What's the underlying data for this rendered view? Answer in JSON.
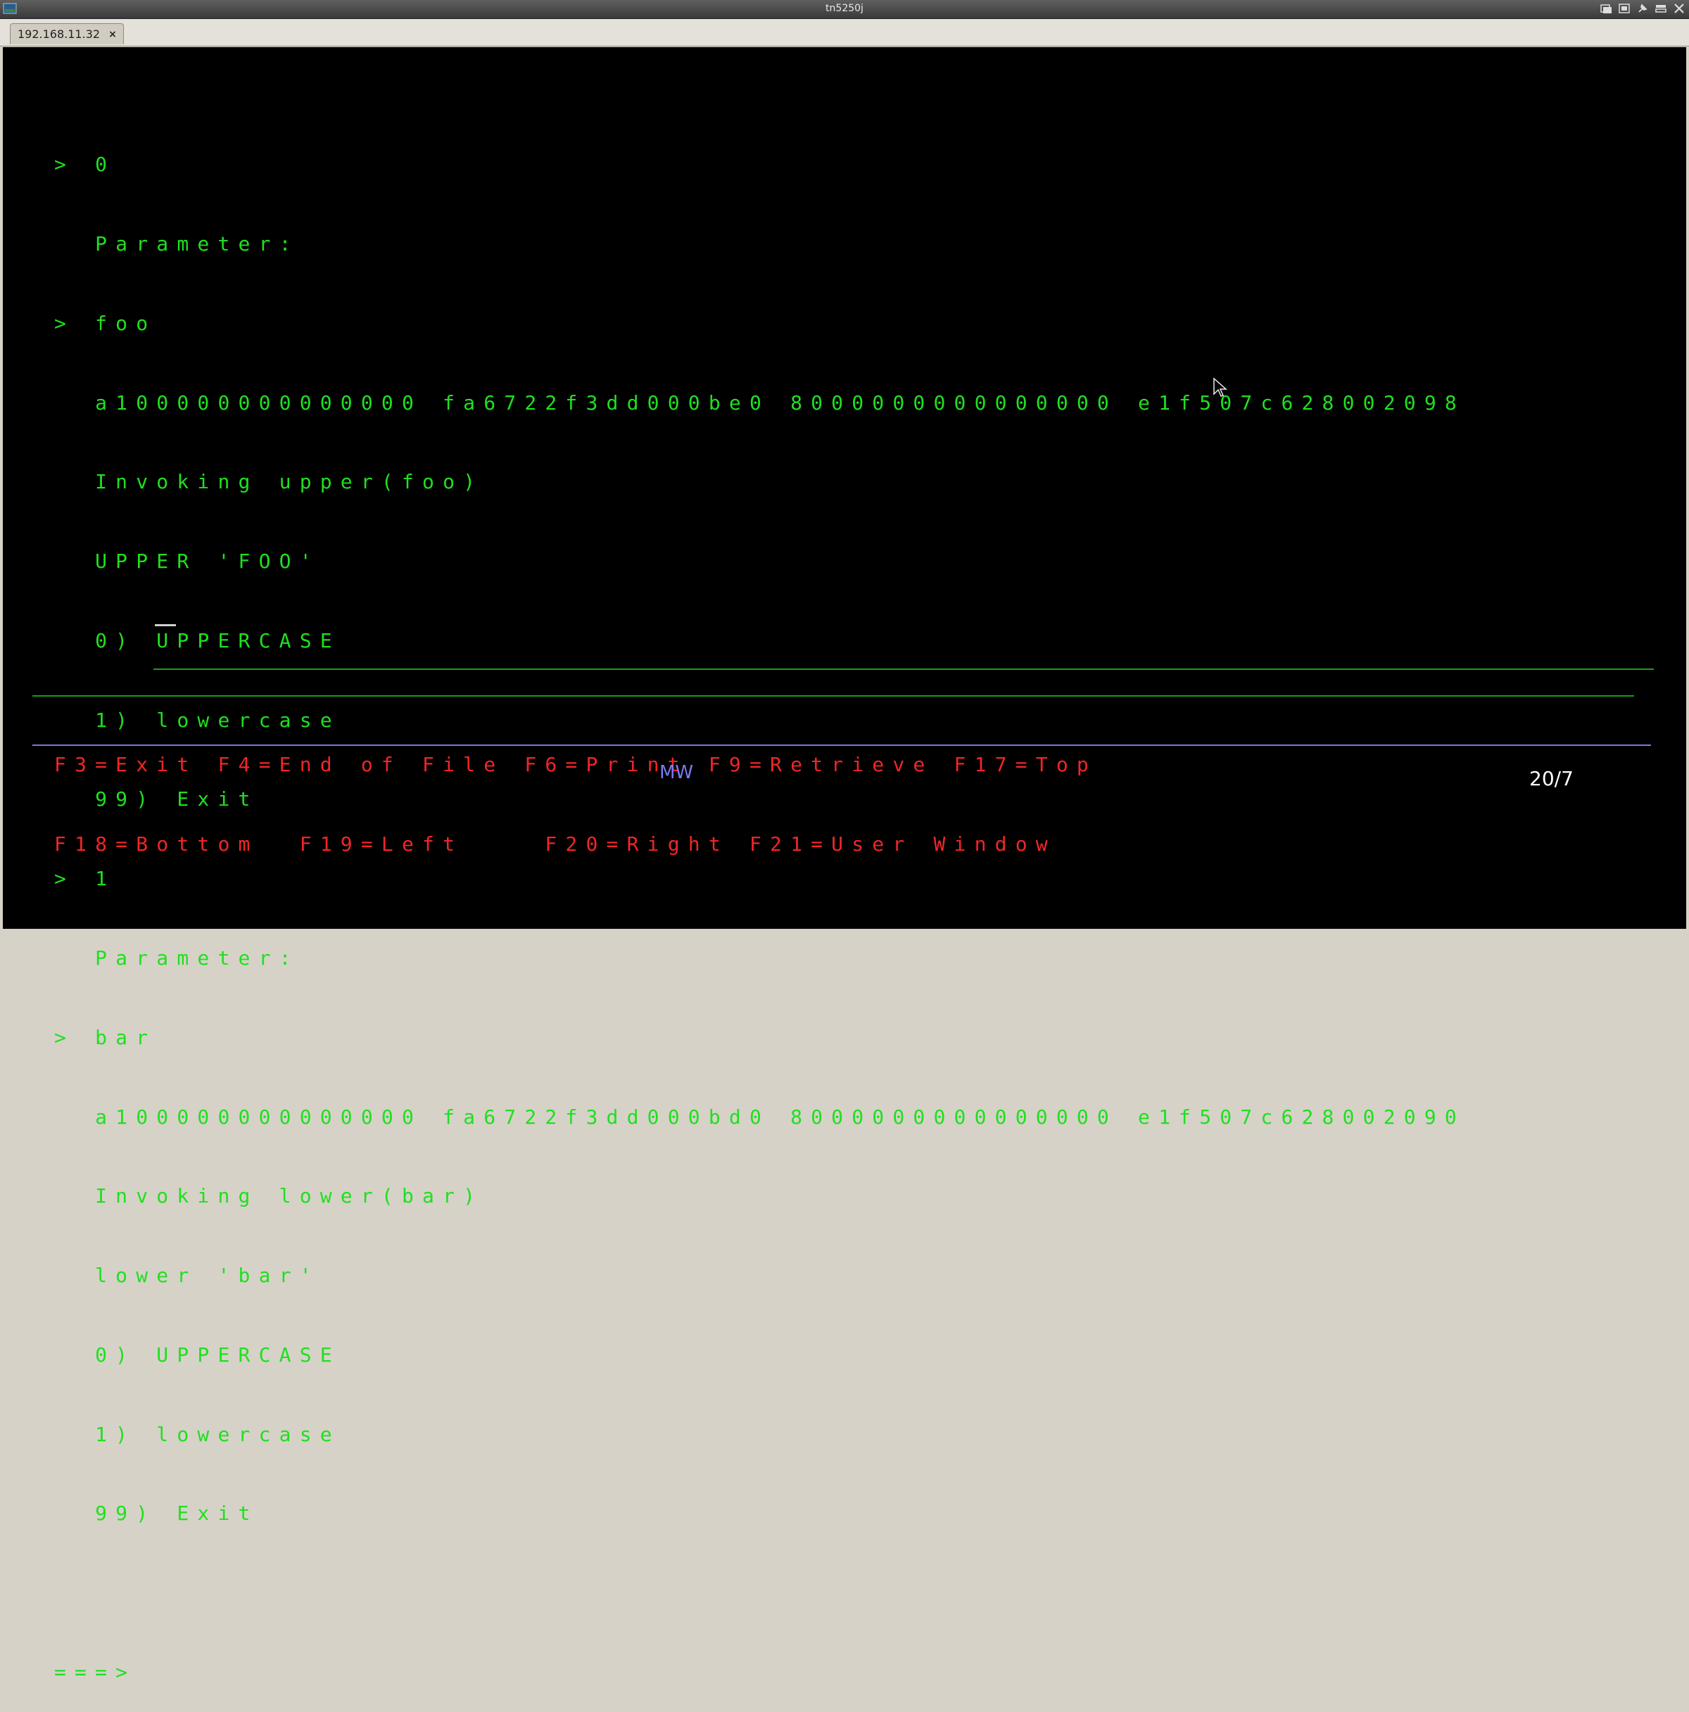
{
  "window": {
    "title": "tn5250j",
    "buttons": [
      "iconify-icon",
      "maximize-icon",
      "pin-icon",
      "shade-icon",
      "close-icon"
    ]
  },
  "tab": {
    "label": "192.168.11.32",
    "close_label": "×"
  },
  "terminal": {
    "lines": [
      "> 0",
      "  Parameter:",
      "> foo",
      "  a100000000000000 fa6722f3dd000be0 8000000000000000 e1f507c628002098",
      "  Invoking upper(foo)",
      "  UPPER 'FOO'",
      "  0) UPPERCASE",
      "  1) lowercase",
      "  99) Exit",
      "> 1",
      "  Parameter:",
      "> bar",
      "  a100000000000000 fa6722f3dd000bd0 8000000000000000 e1f507c628002090",
      "  Invoking lower(bar)",
      "  lower 'bar'",
      "  0) UPPERCASE",
      "  1) lowercase",
      "  99) Exit"
    ],
    "prompt": "===>",
    "input_value": ""
  },
  "function_keys": {
    "line1": "F3=Exit F4=End of File F6=Print F9=Retrieve F17=Top",
    "line2": "F18=Bottom  F19=Left    F20=Right F21=User Window"
  },
  "status": {
    "mode": "MW",
    "cursor_position": "20/7"
  },
  "colors": {
    "terminal_bg": "#000000",
    "text_green": "#1fe01f",
    "fkey_red": "#f22525",
    "status_blue": "#7b7bf2"
  }
}
